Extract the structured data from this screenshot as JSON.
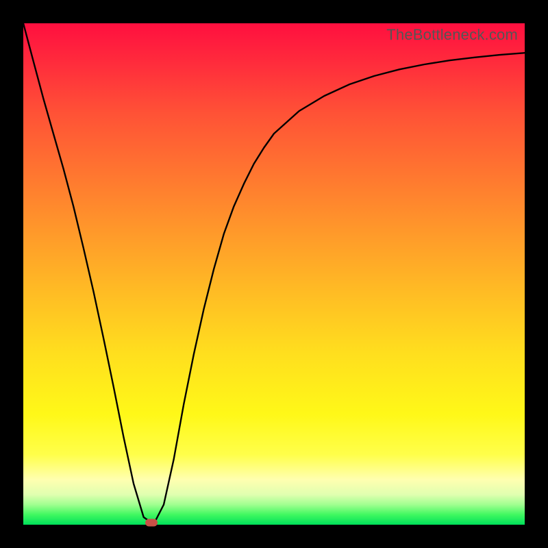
{
  "watermark": "TheBottleneck.com",
  "chart_data": {
    "type": "line",
    "title": "",
    "xlabel": "",
    "ylabel": "",
    "xlim": [
      0,
      100
    ],
    "ylim": [
      0,
      100
    ],
    "x": [
      0,
      2,
      4,
      6,
      8,
      10,
      12,
      14,
      16,
      18,
      20,
      22,
      24,
      26,
      28,
      30,
      32,
      34,
      36,
      38,
      40,
      42,
      44,
      46,
      48,
      50,
      55,
      60,
      65,
      70,
      75,
      80,
      85,
      90,
      95,
      100
    ],
    "values": [
      100,
      92.5,
      85,
      78,
      71,
      63.5,
      55.2,
      46.5,
      37.2,
      27.5,
      17.5,
      8.2,
      1.5,
      0.1,
      4,
      13,
      24,
      34,
      43,
      51,
      58,
      63.5,
      68,
      72,
      75.2,
      78,
      82.5,
      85.5,
      87.8,
      89.5,
      90.8,
      91.8,
      92.6,
      93.2,
      93.7,
      94.1
    ],
    "min_marker": {
      "x": 25.5,
      "y": 0
    },
    "background_gradient": [
      "#ff0f3f",
      "#ff9a2a",
      "#fff818",
      "#00e05a"
    ]
  }
}
